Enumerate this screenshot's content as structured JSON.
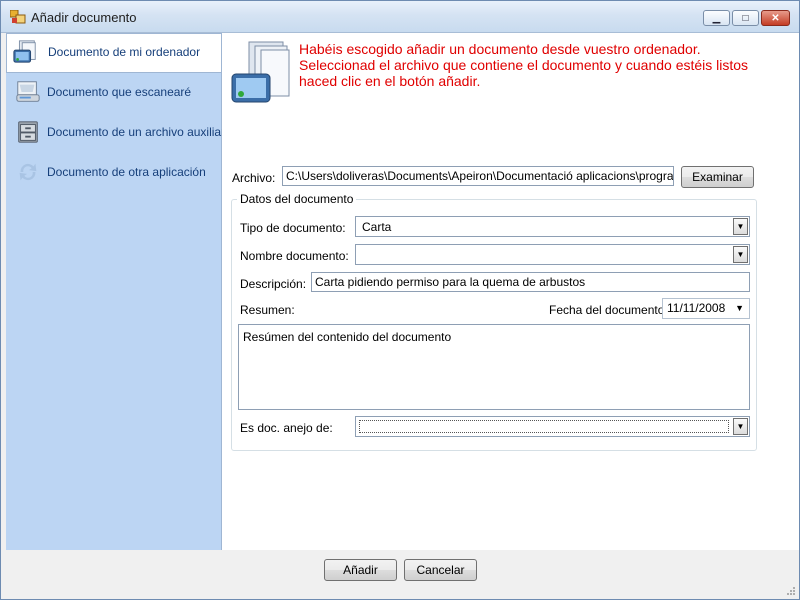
{
  "window": {
    "title": "Añadir documento",
    "minimize_glyph": "▁",
    "maximize_glyph": "□",
    "close_glyph": "✕"
  },
  "sidebar": {
    "items": [
      {
        "label": "Documento de mi ordenador",
        "icon": "computer-document-icon",
        "selected": true
      },
      {
        "label": "Documento que escanearé",
        "icon": "scanner-icon"
      },
      {
        "label": "Documento de un archivo auxiliar",
        "icon": "archive-icon"
      },
      {
        "label": "Documento de otra aplicación",
        "icon": "sync-arrows-icon",
        "disabled": true
      }
    ]
  },
  "main": {
    "message": "Habéis escogido añadir un documento desde vuestro ordenador. Seleccionad el archivo que contiene el documento y cuando estéis listos haced clic en el botón añadir.",
    "archivo_label": "Archivo:",
    "archivo_value": "C:\\Users\\doliveras\\Documents\\Apeiron\\Documentació aplicacions\\programes\\Ar",
    "examinar_label": "Examinar",
    "group_title": "Datos del documento",
    "tipo_label": "Tipo de documento:",
    "tipo_value": "Carta",
    "nombre_label": "Nombre documento:",
    "nombre_value": "",
    "descripcion_label": "Descripción:",
    "descripcion_value": "Carta pidiendo permiso para la quema de arbustos",
    "resumen_label": "Resumen:",
    "fecha_label": "Fecha del documento:",
    "fecha_value": "11/11/2008",
    "resumen_value": "Resúmen del contenido del documento",
    "anejo_label": "Es doc. anejo de:",
    "anejo_value": ""
  },
  "footer": {
    "add_label": "Añadir",
    "cancel_label": "Cancelar"
  },
  "colors": {
    "message": "#e00000",
    "sidebar": "#bcd5f3",
    "nav_text": "#163f7a"
  }
}
